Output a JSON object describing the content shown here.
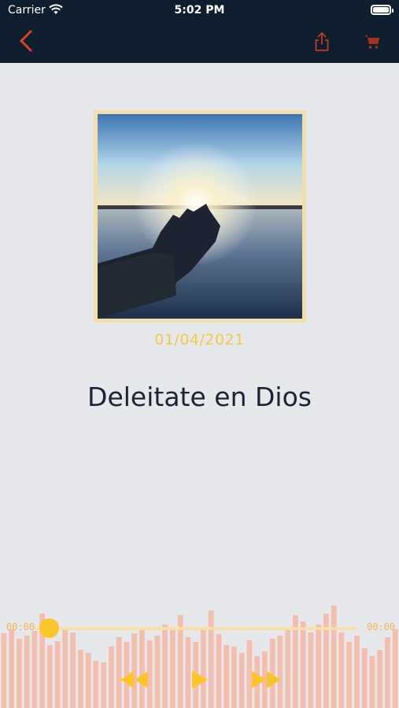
{
  "status_bar": {
    "carrier": "Carrier",
    "time": "5:02 PM"
  },
  "nav": {
    "back_icon": "chevron-left-icon",
    "share_icon": "share-icon",
    "cart_icon": "cart-icon"
  },
  "episode": {
    "date": "01/04/2021",
    "title": "Deleitate en Dios"
  },
  "player": {
    "elapsed": "00:00",
    "duration": "00:00",
    "progress": 0,
    "controls": [
      "rewind-icon",
      "play-icon",
      "fast-forward-icon"
    ]
  },
  "colors": {
    "accent": "#f2c94c",
    "nav_bg": "#0f1e2f",
    "icon_red": "#e0431f",
    "waveform": "#f6b6a4"
  }
}
